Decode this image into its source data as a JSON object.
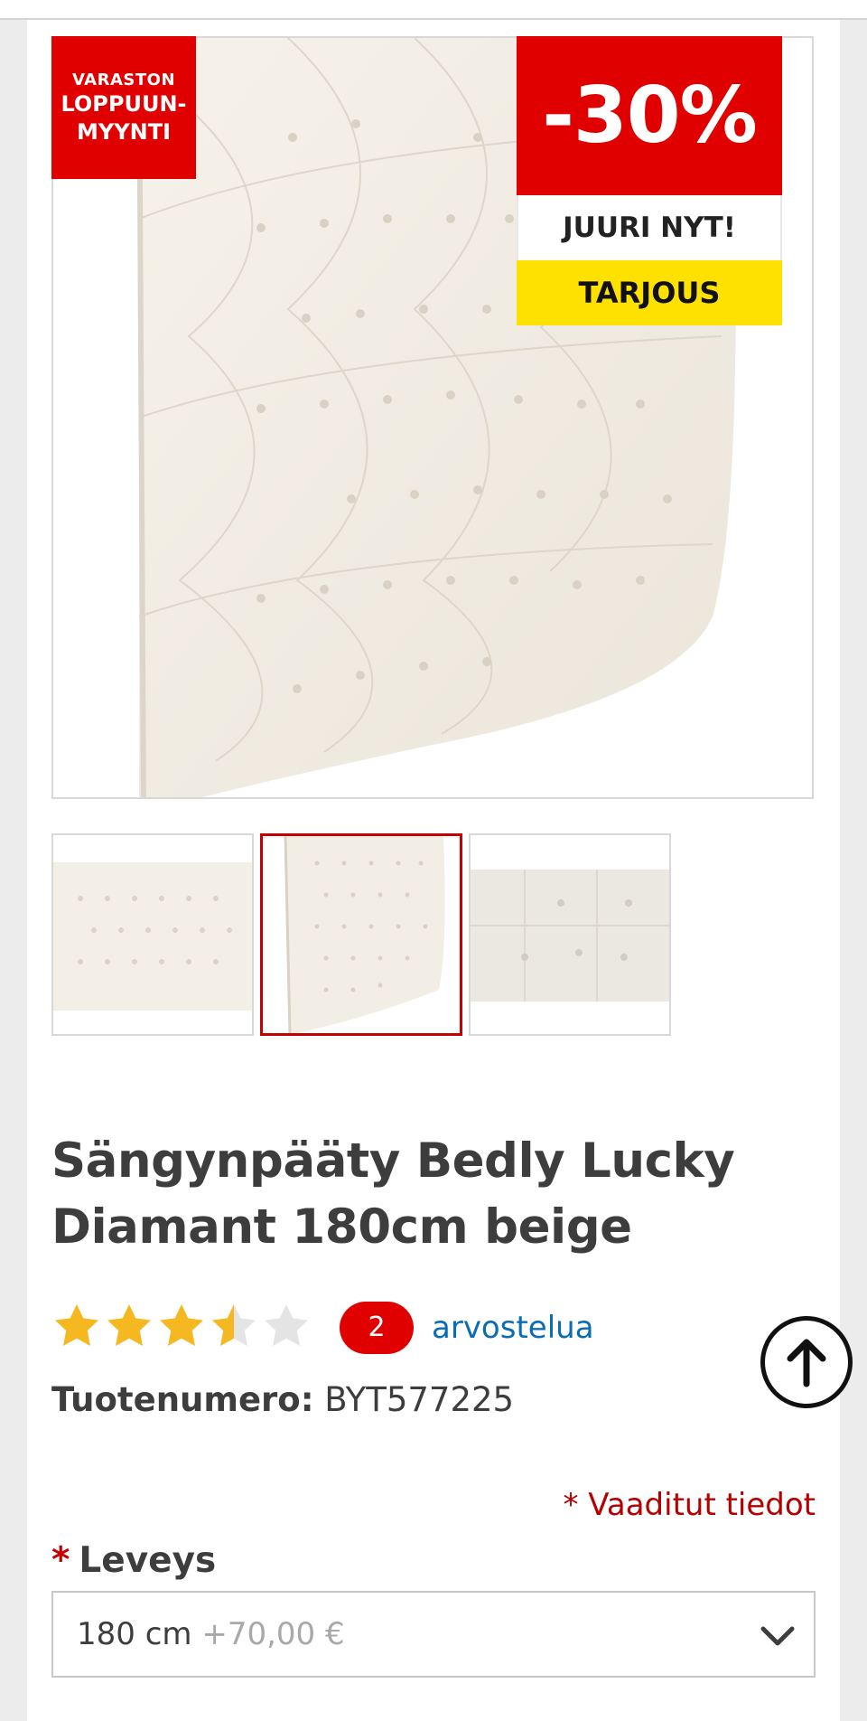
{
  "badges": {
    "clearance": [
      "VARASTON",
      "LOPPUUN-",
      "MYYNTI"
    ],
    "discount": "-30%",
    "now": "JUURI NYT!",
    "offer": "TARJOUS"
  },
  "product": {
    "title_line1": "Sängynpääty Bedly Lucky",
    "title_line2": "Diamant 180cm beige",
    "rating": 3.5,
    "rating_max": 5,
    "review_count": "2",
    "review_link": "arvostelua",
    "sku_label": "Tuotenumero:",
    "sku_value": "BYT577225"
  },
  "form": {
    "required_note": "* Vaaditut tiedot",
    "field_required_mark": "*",
    "field_label": "Leveys",
    "select_value": "180 cm",
    "select_price": "+70,00 €"
  },
  "colors": {
    "brand_red": "#e10000",
    "offer_yellow": "#ffe100",
    "star_gold": "#f5b820",
    "link_blue": "#0a6cb3"
  },
  "icons": {
    "scroll_top": "arrow-up-circle-icon",
    "select": "chevron-down-icon",
    "rating": "star-icon"
  }
}
